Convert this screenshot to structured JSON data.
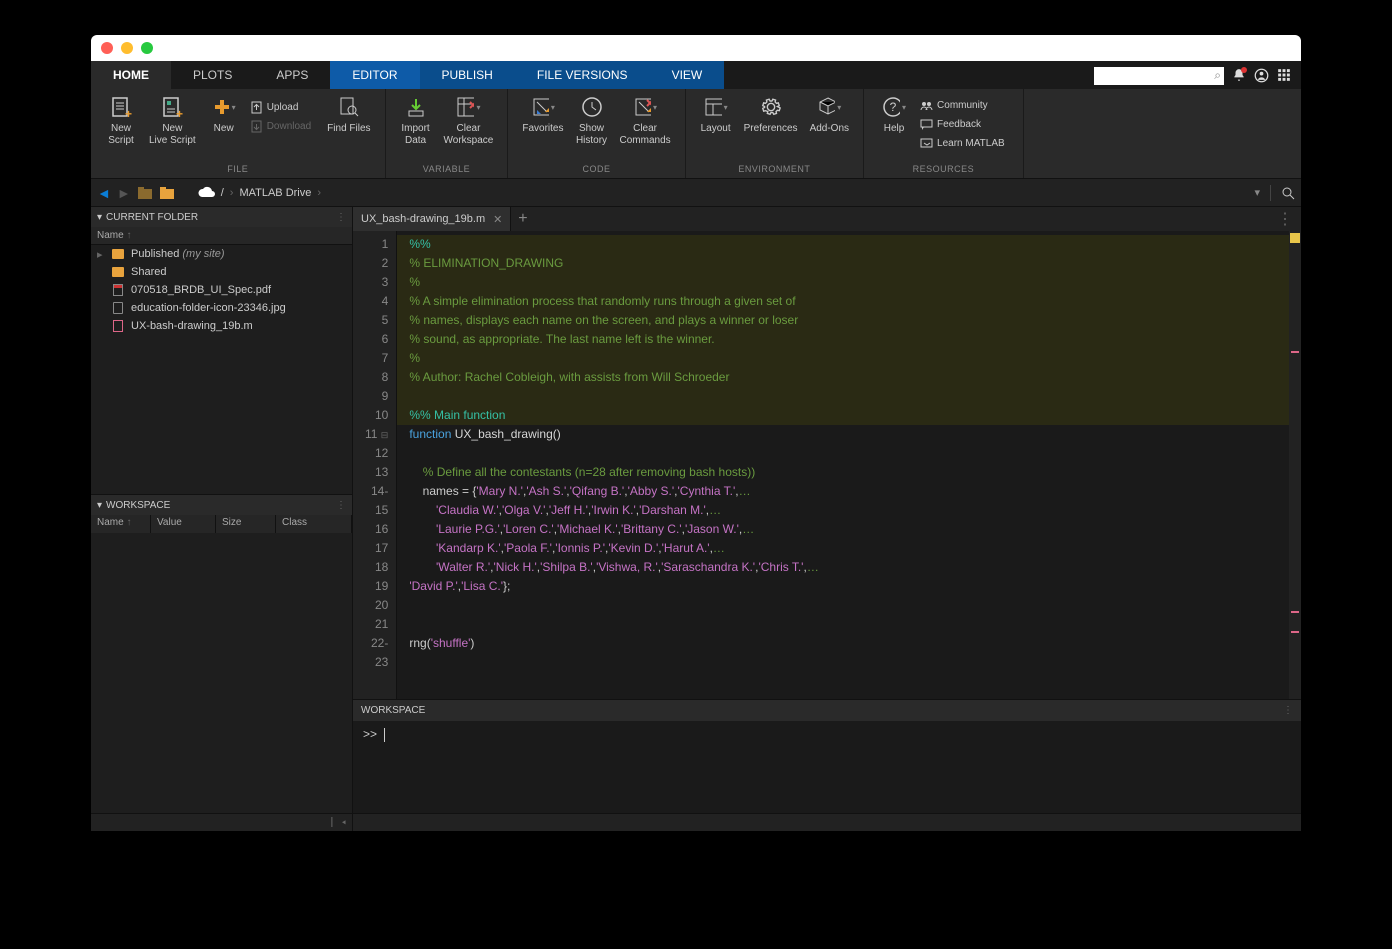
{
  "main_tabs": {
    "home": "HOME",
    "plots": "PLOTS",
    "apps": "APPS",
    "editor": "EDITOR",
    "publish": "PUBLISH",
    "file_versions": "FILE VERSIONS",
    "view": "VIEW"
  },
  "toolstrip": {
    "file": {
      "new_script": "New\nScript",
      "new_live_script": "New\nLive Script",
      "new": "New",
      "upload": "Upload",
      "download": "Download",
      "find_files": "Find Files",
      "group": "FILE"
    },
    "variable": {
      "import": "Import\nData",
      "clear_ws": "Clear\nWorkspace",
      "group": "VARIABLE"
    },
    "code": {
      "favorites": "Favorites",
      "show_history": "Show\nHistory",
      "clear_cmds": "Clear\nCommands",
      "group": "CODE"
    },
    "env": {
      "layout": "Layout",
      "preferences": "Preferences",
      "addons": "Add-Ons",
      "group": "ENVIRONMENT"
    },
    "resources": {
      "help": "Help",
      "community": "Community",
      "feedback": "Feedback",
      "learn": "Learn MATLAB",
      "group": "RESOURCES"
    }
  },
  "pathbar": {
    "root": "/",
    "drive": "MATLAB Drive"
  },
  "current_folder": {
    "title": "CURRENT FOLDER",
    "name_col": "Name",
    "items": [
      {
        "name": "Published",
        "suffix": "(my site)",
        "type": "folder",
        "expandable": true
      },
      {
        "name": "Shared",
        "type": "folder"
      },
      {
        "name": "070518_BRDB_UI_Spec.pdf",
        "type": "pdf"
      },
      {
        "name": "education-folder-icon-23346.jpg",
        "type": "file"
      },
      {
        "name": "UX-bash-drawing_19b.m",
        "type": "m"
      }
    ]
  },
  "workspace": {
    "title": "WORKSPACE",
    "cols": {
      "name": "Name",
      "value": "Value",
      "size": "Size",
      "class": "Class"
    }
  },
  "editor_tab": {
    "filename": "UX_bash-drawing_19b.m"
  },
  "code_lines": [
    {
      "n": 1,
      "section": true,
      "html": "<span class='sc'>%%</span>"
    },
    {
      "n": 2,
      "section": true,
      "html": "<span class='c'>% ELIMINATION_DRAWING</span>"
    },
    {
      "n": 3,
      "section": true,
      "html": "<span class='c'>%</span>"
    },
    {
      "n": 4,
      "section": true,
      "html": "<span class='c'>% A simple elimination process that randomly runs through a given set of</span>"
    },
    {
      "n": 5,
      "section": true,
      "html": "<span class='c'>% names, displays each name on the screen, and plays a winner or loser</span>"
    },
    {
      "n": 6,
      "section": true,
      "html": "<span class='c'>% sound, as appropriate. The last name left is the winner.</span>"
    },
    {
      "n": 7,
      "section": true,
      "html": "<span class='c'>%</span>"
    },
    {
      "n": 8,
      "section": true,
      "html": "<span class='c'>% Author: Rachel Cobleigh, with assists from Will Schroeder</span>"
    },
    {
      "n": 9,
      "section": true,
      "html": " "
    },
    {
      "n": 10,
      "section": true,
      "html": "<span class='sc'>%% Main function</span>"
    },
    {
      "n": 11,
      "html": "<span class='kw'>function</span> <span class='fn'>UX_bash_drawing()</span>",
      "fold": true
    },
    {
      "n": 12,
      "html": " "
    },
    {
      "n": 13,
      "html": "    <span class='c'>% Define all the contestants (n=28 after removing bash hosts))</span>"
    },
    {
      "n": 14,
      "suffix": "-",
      "html": "    names = {<span class='str'>'Mary N.'</span>,<span class='str'>'Ash S.'</span>,<span class='str'>'Qifang B.'</span>,<span class='str'>'Abby S.'</span>,<span class='str'>'Cynthia T.'</span>,<span class='c'>…</span>"
    },
    {
      "n": 15,
      "html": "        <span class='str'>'Claudia W.'</span>,<span class='str'>'Olga V.'</span>,<span class='str'>'Jeff H.'</span>,<span class='str'>'Irwin K.'</span>,<span class='str'>'Darshan M.'</span>,<span class='c'>…</span>"
    },
    {
      "n": 16,
      "html": "        <span class='str'>'Laurie P.G.'</span>,<span class='str'>'Loren C.'</span>,<span class='str'>'Michael K.'</span>,<span class='str'>'Brittany C.'</span>,<span class='str'>'Jason W.'</span>,<span class='c'>…</span>"
    },
    {
      "n": 17,
      "html": "        <span class='str'>'Kandarp K.'</span>,<span class='str'>'Paola F.'</span>,<span class='str'>'Ionnis P.'</span>,<span class='str'>'Kevin D.'</span>,<span class='str'>'Harut A.'</span>,<span class='c'>…</span>"
    },
    {
      "n": 18,
      "html": "        <span class='str'>'Walter R.'</span>,<span class='str'>'Nick H.'</span>,<span class='str'>'Shilpa B.'</span>,<span class='str'>'Vishwa, R.'</span>,<span class='str'>'Saraschandra K.'</span>,<span class='str'>'Chris T.'</span>,<span class='c'>…</span>"
    },
    {
      "n": 19,
      "html": "<span class='str'>'David P.'</span>,<span class='str'>'Lisa C.'</span>};"
    },
    {
      "n": 20,
      "html": " "
    },
    {
      "n": 21,
      "html": " "
    },
    {
      "n": 22,
      "suffix": "-",
      "html": "rng(<span class='str'>'shuffle'</span>)"
    },
    {
      "n": 23,
      "html": " "
    }
  ],
  "command_window": {
    "title": "WORKSPACE",
    "prompt": ">>"
  }
}
